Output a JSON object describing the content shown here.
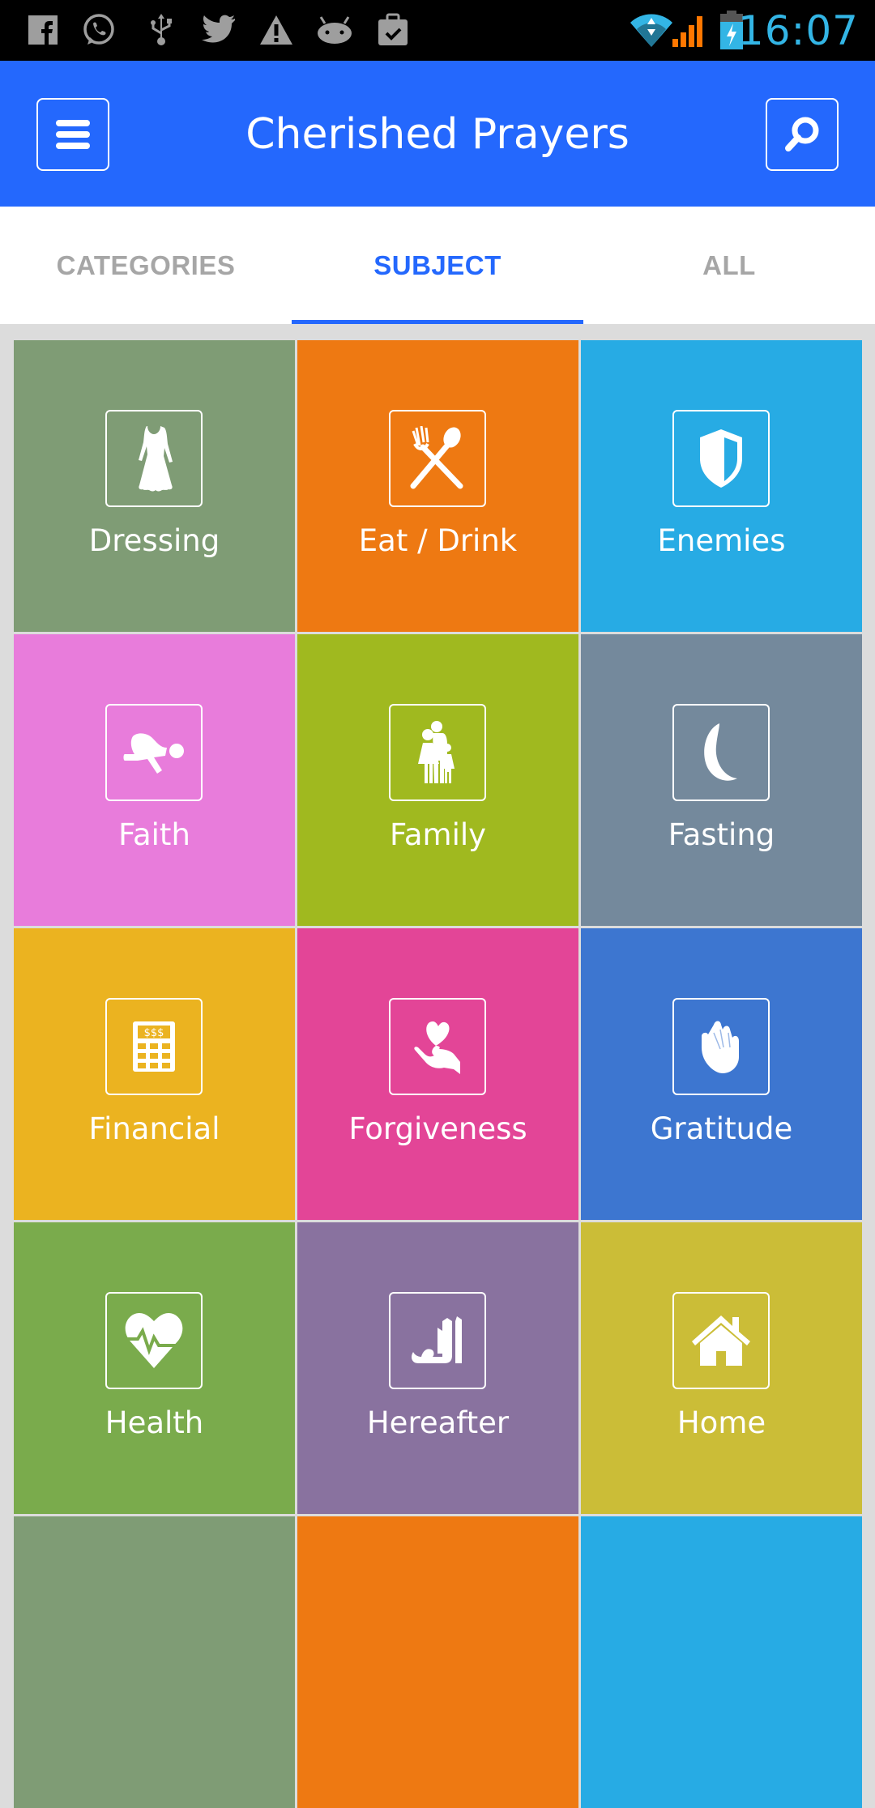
{
  "status_bar": {
    "notification_icons": [
      "facebook-icon",
      "whatsapp-icon",
      "usb-icon",
      "twitter-icon",
      "warning-icon",
      "android-icon",
      "clipboard-check-icon"
    ],
    "system_icons": [
      "wifi-icon",
      "cellular-signal-icon",
      "battery-charging-icon"
    ],
    "time": "16:07",
    "colors": {
      "clock": "#33b5e5",
      "signal": "#ff7700",
      "wifi": "#33b5e5"
    }
  },
  "app_bar": {
    "title": "Cherished Prayers",
    "menu_icon": "hamburger-menu-icon",
    "search_icon": "search-icon",
    "color": "#2468fd"
  },
  "tabs": [
    {
      "label": "CATEGORIES",
      "active": false
    },
    {
      "label": "SUBJECT",
      "active": true
    },
    {
      "label": "ALL",
      "active": false
    }
  ],
  "subjects": [
    {
      "label": "Dressing",
      "icon": "dress-icon",
      "color": "#7f9c75"
    },
    {
      "label": "Eat / Drink",
      "icon": "fork-spoon-icon",
      "color": "#ee7912"
    },
    {
      "label": "Enemies",
      "icon": "shield-icon",
      "color": "#27abe4"
    },
    {
      "label": "Faith",
      "icon": "prostrating-person-icon",
      "color": "#e87cdb"
    },
    {
      "label": "Family",
      "icon": "family-icon",
      "color": "#a0b91f"
    },
    {
      "label": "Fasting",
      "icon": "crescent-moon-icon",
      "color": "#74899c"
    },
    {
      "label": "Financial",
      "icon": "calculator-icon",
      "color": "#ebb320"
    },
    {
      "label": "Forgiveness",
      "icon": "heart-in-hand-icon",
      "color": "#e34597"
    },
    {
      "label": "Gratitude",
      "icon": "praying-hands-icon",
      "color": "#3d76d0"
    },
    {
      "label": "Health",
      "icon": "heart-pulse-icon",
      "color": "#7aab4c"
    },
    {
      "label": "Hereafter",
      "icon": "allah-calligraphy-icon",
      "color": "#89729f"
    },
    {
      "label": "Home",
      "icon": "house-icon",
      "color": "#cbbd37"
    },
    {
      "label": "",
      "icon": "",
      "color": "#7f9c75"
    },
    {
      "label": "",
      "icon": "",
      "color": "#ee7912"
    },
    {
      "label": "",
      "icon": "",
      "color": "#27abe4"
    }
  ]
}
